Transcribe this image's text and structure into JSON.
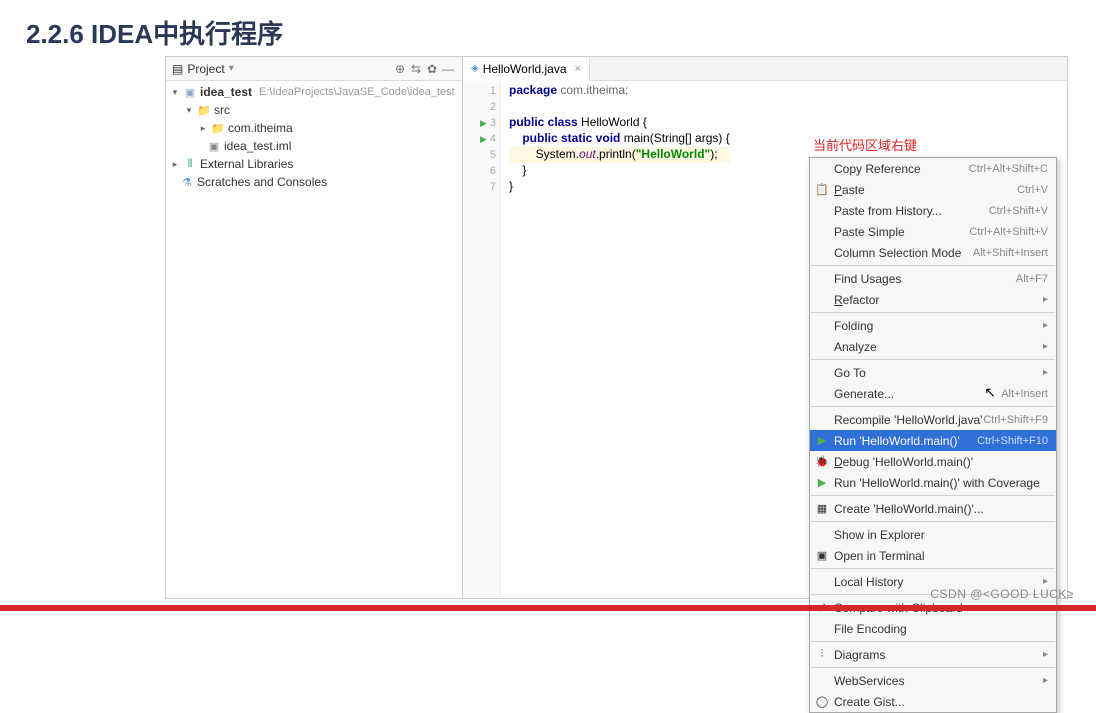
{
  "page": {
    "heading": "2.2.6 IDEA中执行程序",
    "watermark": "CSDN @<GOOD LUCK≥"
  },
  "annotation": {
    "red_text": "当前代码区域右键"
  },
  "project_panel": {
    "title": "Project",
    "tree": {
      "root": {
        "name": "idea_test",
        "path": "E:\\IdeaProjects\\JavaSE_Code\\idea_test"
      },
      "src": "src",
      "package": "com.itheima",
      "iml": "idea_test.iml",
      "external": "External Libraries",
      "scratches": "Scratches and Consoles"
    }
  },
  "editor": {
    "tab": {
      "name": "HelloWorld.java"
    },
    "code": {
      "l1_kw": "package",
      "l1_pkg": " com.itheima;",
      "l3_kw": "public class",
      "l3_name": " HelloWorld {",
      "l4_kw": "    public static void",
      "l4_rest": " main(String[] args) {",
      "l5_pre": "        System.",
      "l5_out": "out",
      "l5_mid": ".println(",
      "l5_str": "\"HelloWorld\"",
      "l5_end": ");",
      "l6": "    }",
      "l7": "}"
    },
    "gutter": [
      "1",
      "2",
      "3",
      "4",
      "5",
      "6",
      "7"
    ]
  },
  "context_menu": {
    "items": [
      {
        "label": "Copy Reference",
        "shortcut": "Ctrl+Alt+Shift+C"
      },
      {
        "label": "Paste",
        "shortcut": "Ctrl+V",
        "icon": "📋"
      },
      {
        "label": "Paste from History...",
        "shortcut": "Ctrl+Shift+V"
      },
      {
        "label": "Paste Simple",
        "shortcut": "Ctrl+Alt+Shift+V"
      },
      {
        "label": "Column Selection Mode",
        "shortcut": "Alt+Shift+Insert"
      }
    ],
    "find_usages": {
      "label": "Find Usages",
      "shortcut": "Alt+F7"
    },
    "refactor": {
      "label": "Refactor"
    },
    "folding": {
      "label": "Folding"
    },
    "analyze": {
      "label": "Analyze"
    },
    "goto": {
      "label": "Go To"
    },
    "generate": {
      "label": "Generate...",
      "shortcut": "Alt+Insert"
    },
    "recompile": {
      "label": "Recompile 'HelloWorld.java'",
      "shortcut": "Ctrl+Shift+F9"
    },
    "run": {
      "label": "Run 'HelloWorld.main()'",
      "shortcut": "Ctrl+Shift+F10"
    },
    "debug": {
      "label": "Debug 'HelloWorld.main()'"
    },
    "coverage": {
      "label": "Run 'HelloWorld.main()' with Coverage"
    },
    "create": {
      "label": "Create 'HelloWorld.main()'..."
    },
    "explorer": {
      "label": "Show in Explorer"
    },
    "terminal": {
      "label": "Open in Terminal"
    },
    "history": {
      "label": "Local History"
    },
    "compare": {
      "label": "Compare with Clipboard"
    },
    "encoding": {
      "label": "File Encoding"
    },
    "diagrams": {
      "label": "Diagrams"
    },
    "webservices": {
      "label": "WebServices"
    },
    "gist": {
      "label": "Create Gist..."
    }
  }
}
